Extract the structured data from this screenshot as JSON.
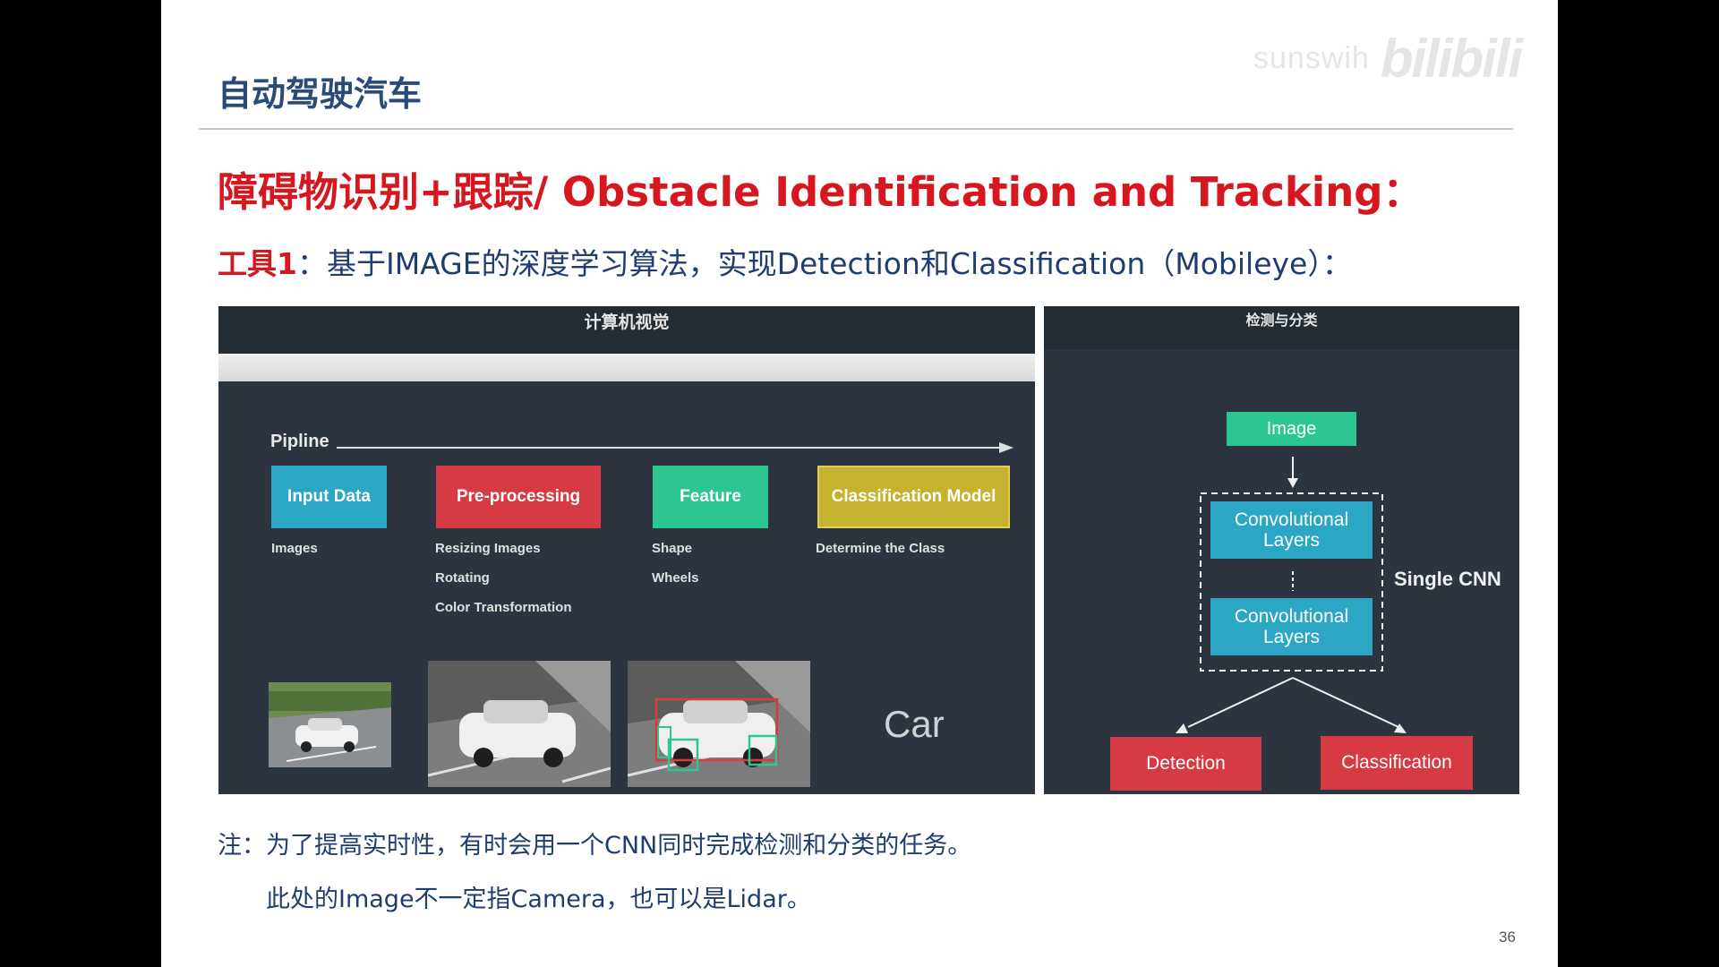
{
  "watermark": {
    "user": "sunswih",
    "logo": "bilibili"
  },
  "header": {
    "title": "自动驾驶汽车"
  },
  "title": "障碍物识别+跟踪/ Obstacle Identification and Tracking：",
  "subtitle": {
    "tool_label": "工具1",
    "text": "：基于IMAGE的深度学习算法，实现Detection和Classification（Mobileye）："
  },
  "left_panel": {
    "title": "计算机视觉",
    "pipline_label": "Pipline",
    "stages": [
      {
        "label": "Input Data",
        "color": "#2ba7c5",
        "items": [
          "Images"
        ]
      },
      {
        "label": "Pre-processing",
        "color": "#d63a42",
        "items": [
          "Resizing Images",
          "Rotating",
          "Color Transformation"
        ]
      },
      {
        "label": "Feature",
        "color": "#2cc791",
        "items": [
          "Shape",
          "Wheels"
        ]
      },
      {
        "label": "Classification Model",
        "color": "#c6b22e",
        "items": [
          "Determine the Class"
        ]
      }
    ],
    "result_label": "Car"
  },
  "right_panel": {
    "title": "检测与分类",
    "image_label": "Image",
    "conv_label_1": "Convolutional Layers",
    "conv_label_2": "Convolutional Layers",
    "single_cnn_label": "Single CNN",
    "detection_label": "Detection",
    "classification_label": "Classification"
  },
  "notes": [
    "注：为了提高实时性，有时会用一个CNN同时完成检测和分类的任务。",
    "此处的Image不一定指Camera，也可以是Lidar。"
  ],
  "page_number": "36"
}
